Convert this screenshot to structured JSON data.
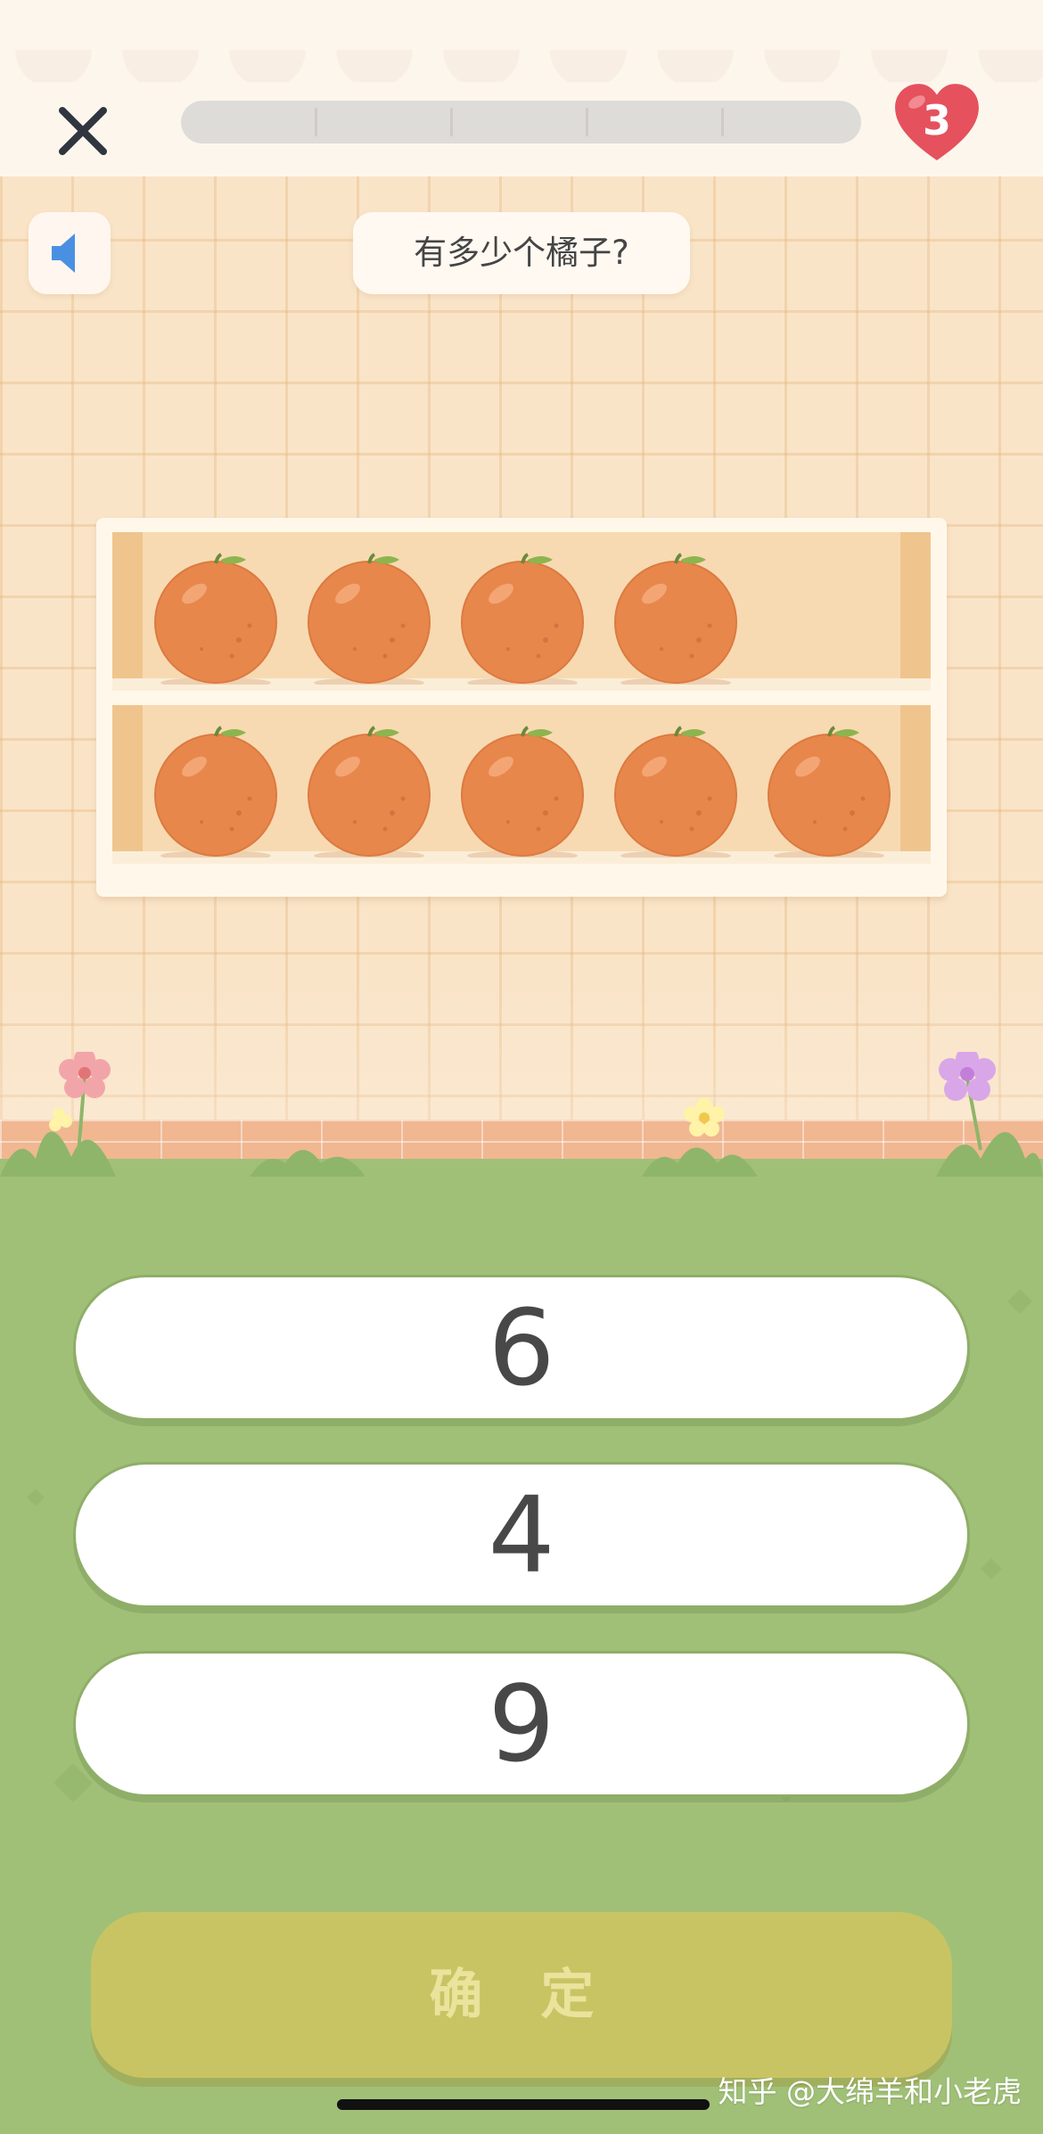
{
  "header": {
    "close_icon": "close-icon",
    "progress": 0,
    "progress_segments": 5,
    "lives": "3",
    "lives_icon": "heart-icon"
  },
  "question": {
    "sound_icon": "speaker-icon",
    "text": "有多少个橘子?"
  },
  "shelf": {
    "rows": [
      {
        "oranges": 4
      },
      {
        "oranges": 5
      }
    ]
  },
  "answers": {
    "options": [
      "6",
      "4",
      "9"
    ]
  },
  "confirm": {
    "label": "确 定",
    "enabled": false
  },
  "watermark": "知乎 @大绵羊和小老虎",
  "colors": {
    "accent_orange": "#f2a23a",
    "lawn": "#a0c077",
    "confirm_bg": "#c8c464",
    "heart": "#e5515c"
  }
}
